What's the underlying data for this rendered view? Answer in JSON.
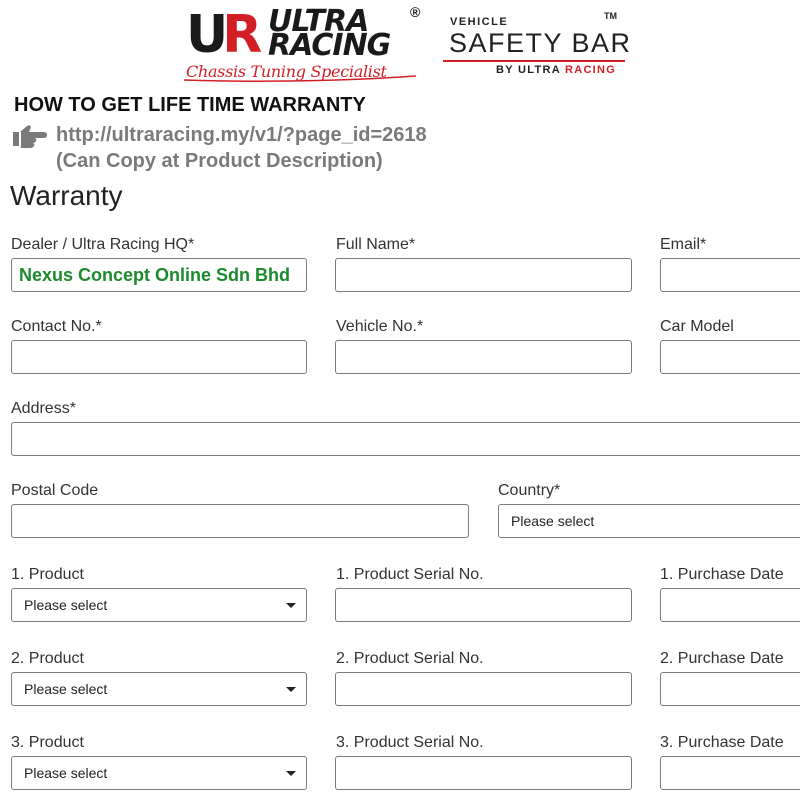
{
  "brand": {
    "ur_left": "U",
    "ur_right": "R",
    "ultra": "ULTRA",
    "racing": "RACING",
    "registered": "®",
    "tagline": "Chassis Tuning Specialist",
    "accent_color": "#d21f26"
  },
  "safety_bar": {
    "vehicle": "VEHICLE",
    "tm": "TM",
    "title": "SAFETY BAR",
    "by_prefix": "BY ULTRA ",
    "by_accent": "RACING"
  },
  "instructions": {
    "heading": "HOW TO GET LIFE TIME WARRANTY",
    "pointer_icon": "hand-pointing-right-icon",
    "url": "http://ultraracing.my/v1/?page_id=2618",
    "note": "(Can Copy at Product Description)"
  },
  "form": {
    "title": "Warranty",
    "dealer_label": "Dealer / Ultra Racing HQ*",
    "dealer_value": "Nexus Concept Online Sdn Bhd",
    "full_name_label": "Full Name*",
    "email_label": "Email*",
    "contact_label": "Contact No.*",
    "vehicle_label": "Vehicle No.*",
    "car_model_label": "Car Model",
    "address_label": "Address*",
    "postal_label": "Postal Code",
    "country_label": "Country*",
    "country_value": "Please select",
    "products": [
      {
        "product_label": "1. Product",
        "product_value": "Please select",
        "serial_label": "1. Product Serial No.",
        "date_label": "1. Purchase Date"
      },
      {
        "product_label": "2. Product",
        "product_value": "Please select",
        "serial_label": "2. Product Serial No.",
        "date_label": "2. Purchase Date"
      },
      {
        "product_label": "3. Product",
        "product_value": "Please select",
        "serial_label": "3. Product Serial No.",
        "date_label": "3. Purchase Date"
      }
    ]
  }
}
